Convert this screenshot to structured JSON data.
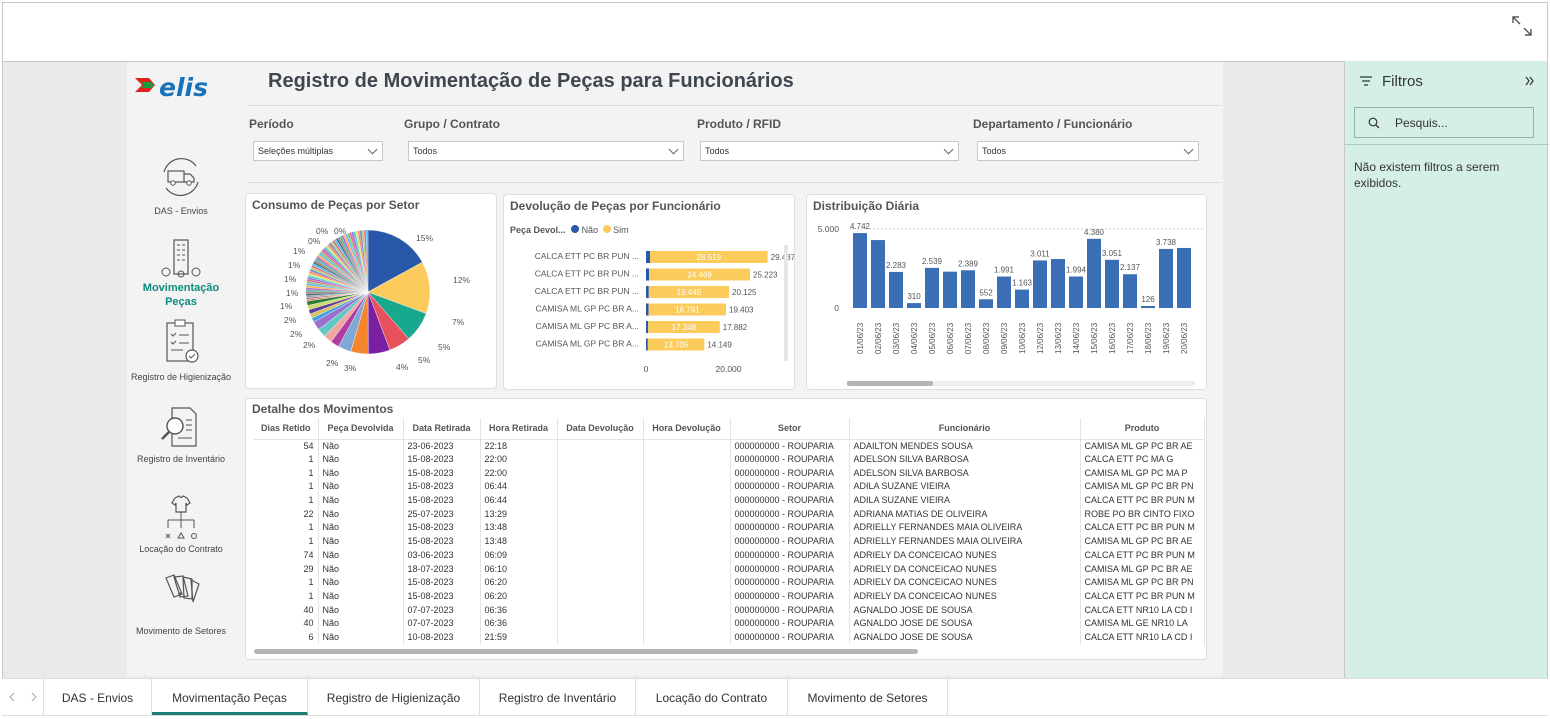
{
  "report_title": "Registro de Movimentação de Peças para Funcionários",
  "logo_text": "elis",
  "nav": [
    {
      "label": "DAS - Envios",
      "icon": "truck-cycle-icon"
    },
    {
      "label": "Movimentação Peças",
      "icon": "building-icon",
      "active": true
    },
    {
      "label": "Registro de Higienização",
      "icon": "clipboard-check-icon"
    },
    {
      "label": "Registro de Inventário",
      "icon": "document-search-icon"
    },
    {
      "label": "Locação do Contrato",
      "icon": "shirt-hierarchy-icon"
    },
    {
      "label": "Movimento de Setores",
      "icon": "fabric-swatch-icon"
    }
  ],
  "filters_bar": {
    "periodo": {
      "label": "Período",
      "value": "Seleções múltiplas"
    },
    "grupo": {
      "label": "Grupo / Contrato",
      "value": "Todos"
    },
    "produto": {
      "label": "Produto / RFID",
      "value": "Todos"
    },
    "departamento": {
      "label": "Departamento / Funcionário",
      "value": "Todos"
    }
  },
  "filters_pane": {
    "title": "Filtros",
    "search_placeholder": "Pesquis...",
    "empty_message": "Não existem filtros a serem exibidos."
  },
  "tabs": [
    "DAS - Envios",
    "Movimentação Peças",
    "Registro de Higienização",
    "Registro de Inventário",
    "Locação do Contrato",
    "Movimento de Setores"
  ],
  "active_tab": "Movimentação Peças",
  "table": {
    "title": "Detalhe dos Movimentos",
    "columns": [
      "Dias Retido",
      "Peça Devolvida",
      "Data Retirada",
      "Hora Retirada",
      "Data Devolução",
      "Hora Devolução",
      "Setor",
      "Funcionário",
      "Produto"
    ],
    "rows": [
      [
        "54",
        "Não",
        "23-06-2023",
        "22:18",
        "",
        "",
        "000000000 - ROUPARIA",
        "ADAILTON MENDES SOUSA",
        "CAMISA ML GP PC BR AE"
      ],
      [
        "1",
        "Não",
        "15-08-2023",
        "22:00",
        "",
        "",
        "000000000 - ROUPARIA",
        "ADELSON SILVA BARBOSA",
        "CALCA ETT PC MA G"
      ],
      [
        "1",
        "Não",
        "15-08-2023",
        "22:00",
        "",
        "",
        "000000000 - ROUPARIA",
        "ADELSON SILVA BARBOSA",
        "CAMISA ML GP PC MA P"
      ],
      [
        "1",
        "Não",
        "15-08-2023",
        "06:44",
        "",
        "",
        "000000000 - ROUPARIA",
        "ADILA SUZANE VIEIRA",
        "CAMISA ML GP PC BR PN"
      ],
      [
        "1",
        "Não",
        "15-08-2023",
        "06:44",
        "",
        "",
        "000000000 - ROUPARIA",
        "ADILA SUZANE VIEIRA",
        "CALCA ETT PC BR PUN M"
      ],
      [
        "22",
        "Não",
        "25-07-2023",
        "13:29",
        "",
        "",
        "000000000 - ROUPARIA",
        "ADRIANA MATIAS DE OLIVEIRA",
        "ROBE PO BR CINTO FIXO"
      ],
      [
        "1",
        "Não",
        "15-08-2023",
        "13:48",
        "",
        "",
        "000000000 - ROUPARIA",
        "ADRIELLY FERNANDES MAIA OLIVEIRA",
        "CALCA ETT PC BR PUN M"
      ],
      [
        "1",
        "Não",
        "15-08-2023",
        "13:48",
        "",
        "",
        "000000000 - ROUPARIA",
        "ADRIELLY FERNANDES MAIA OLIVEIRA",
        "CAMISA ML GP PC BR AE"
      ],
      [
        "74",
        "Não",
        "03-06-2023",
        "06:09",
        "",
        "",
        "000000000 - ROUPARIA",
        "ADRIELY DA CONCEICAO NUNES",
        "CALCA ETT PC BR PUN M"
      ],
      [
        "29",
        "Não",
        "18-07-2023",
        "06:10",
        "",
        "",
        "000000000 - ROUPARIA",
        "ADRIELY DA CONCEICAO NUNES",
        "CAMISA ML GP PC BR AE"
      ],
      [
        "1",
        "Não",
        "15-08-2023",
        "06:20",
        "",
        "",
        "000000000 - ROUPARIA",
        "ADRIELY DA CONCEICAO NUNES",
        "CAMISA ML GP PC BR PN"
      ],
      [
        "1",
        "Não",
        "15-08-2023",
        "06:20",
        "",
        "",
        "000000000 - ROUPARIA",
        "ADRIELY DA CONCEICAO NUNES",
        "CALCA ETT PC BR PUN M"
      ],
      [
        "40",
        "Não",
        "07-07-2023",
        "06:36",
        "",
        "",
        "000000000 - ROUPARIA",
        "AGNALDO JOSE DE SOUSA",
        "CALCA ETT NR10 LA CD I"
      ],
      [
        "40",
        "Não",
        "07-07-2023",
        "06:36",
        "",
        "",
        "000000000 - ROUPARIA",
        "AGNALDO JOSE DE SOUSA",
        "CAMISA ML GE NR10 LA"
      ],
      [
        "6",
        "Não",
        "10-08-2023",
        "21:59",
        "",
        "",
        "000000000 - ROUPARIA",
        "AGNALDO JOSE DE SOUSA",
        "CALCA ETT NR10 LA CD I"
      ]
    ]
  },
  "chart_data": [
    {
      "type": "pie",
      "title": "Consumo de Peças por Setor",
      "slice_labels": [
        "15%",
        "12%",
        "7%",
        "5%",
        "5%",
        "4%",
        "3%",
        "2%",
        "2%",
        "2%",
        "2%",
        "1%",
        "1%",
        "1%",
        "1%",
        "1%",
        "0%",
        "0%",
        "0%"
      ],
      "values": [
        15,
        12,
        7,
        5,
        5,
        4,
        3,
        2,
        2,
        2,
        2,
        1,
        1,
        1,
        1,
        1,
        0.4,
        0.4,
        0.4
      ],
      "colors": [
        "#2a58a8",
        "#fbcb5b",
        "#17a88e",
        "#e8505b",
        "#7a1fa2",
        "#f4862d",
        "#7fa8d8",
        "#b03da0",
        "#f2a6a2",
        "#5fc8c4",
        "#9a6fcd",
        "#3fa2dd",
        "#d8c15a",
        "#5e3c99",
        "#c9d96a",
        "#2e7d32",
        "#e57373",
        "#8d6e63",
        "#90a4ae"
      ]
    },
    {
      "type": "bar",
      "title": "Devolução de Peças por Funcionário",
      "legend_title": "Peça Devol...",
      "series": [
        {
          "name": "Não",
          "color": "#2a58a8"
        },
        {
          "name": "Sim",
          "color": "#fbcb5b"
        }
      ],
      "categories": [
        "CALCA ETT PC BR PUN ...",
        "CALCA ETT PC BR PUN ...",
        "CALCA ETT PC BR PUN ...",
        "CAMISA ML GP PC BR A...",
        "CAMISA ML GP PC BR A...",
        "CAMISA ML GP PC BR A..."
      ],
      "nao": [
        968,
        754,
        680,
        612,
        534,
        444
      ],
      "sim": [
        28519,
        24469,
        19445,
        18791,
        17348,
        13705
      ],
      "totals": [
        "29.487",
        "25.223",
        "20.125",
        "19.403",
        "17.882",
        "14.149"
      ],
      "sim_labels": [
        "28.519",
        "24.469",
        "19.445",
        "18.791",
        "17.348",
        "13.705"
      ],
      "x_ticks": [
        "0",
        "20.000"
      ],
      "xlim": [
        0,
        32000
      ]
    },
    {
      "type": "bar",
      "title": "Distribuição Diária",
      "categories": [
        "01/06/23",
        "02/06/23",
        "03/06/23",
        "04/06/23",
        "05/06/23",
        "06/06/23",
        "07/06/23",
        "08/06/23",
        "09/06/23",
        "10/06/23",
        "12/06/23",
        "13/06/23",
        "14/06/23",
        "15/06/23",
        "16/06/23",
        "17/06/23",
        "18/06/23",
        "19/06/23",
        "20/06/23"
      ],
      "values": [
        4742,
        4300,
        2283,
        310,
        2539,
        2300,
        2389,
        552,
        1991,
        1163,
        3011,
        3100,
        1994,
        4380,
        3051,
        2137,
        126,
        3738,
        3800
      ],
      "value_labels": [
        "4.742",
        "",
        "2.283",
        "310",
        "2.539",
        "",
        "2.389",
        "552",
        "1.991",
        "1.163",
        "3.011",
        "",
        "1.994",
        "4.380",
        "3.051",
        "2.137",
        "126",
        "3.738",
        ""
      ],
      "y_ticks": [
        "0",
        "5.000"
      ],
      "ylim": [
        0,
        5000
      ],
      "color": "#3a6fb5"
    }
  ]
}
